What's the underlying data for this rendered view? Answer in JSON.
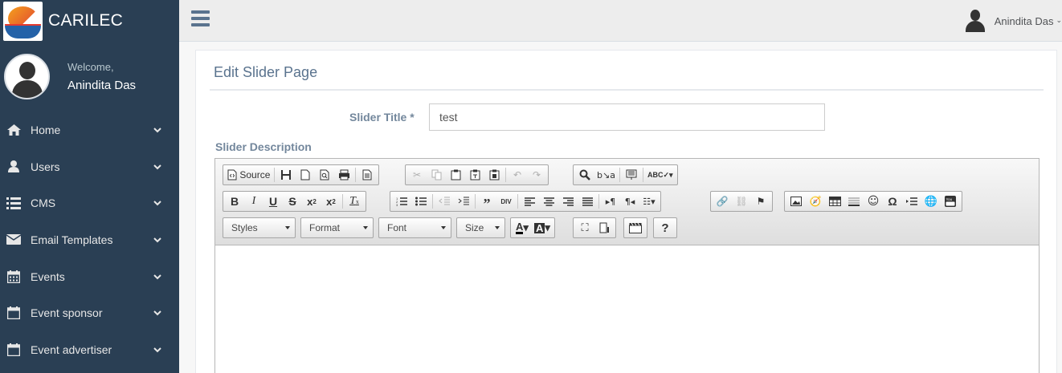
{
  "brand": {
    "name": "CARILEC"
  },
  "profile": {
    "welcome": "Welcome,",
    "name": "Anindita Das"
  },
  "sidebar": {
    "items": [
      {
        "label": "Home",
        "icon": "home-icon"
      },
      {
        "label": "Users",
        "icon": "user-icon"
      },
      {
        "label": "CMS",
        "icon": "list-icon"
      },
      {
        "label": "Email Templates",
        "icon": "envelope-icon"
      },
      {
        "label": "Events",
        "icon": "calendar-icon"
      },
      {
        "label": "Event sponsor",
        "icon": "calendar-icon"
      },
      {
        "label": "Event advertiser",
        "icon": "calendar-icon"
      }
    ]
  },
  "topnav": {
    "user_name": "Anindita Das"
  },
  "page": {
    "title": "Edit Slider Page",
    "slider_title_label": "Slider Title *",
    "slider_title_value": "test",
    "slider_description_label": "Slider Description"
  },
  "editor": {
    "source_label": "Source",
    "styles_label": "Styles",
    "format_label": "Format",
    "font_label": "Font",
    "size_label": "Size",
    "help_label": "?"
  },
  "colors": {
    "sidebar": "#2a3f54",
    "accent": "#5a738e",
    "label": "#73879c"
  }
}
